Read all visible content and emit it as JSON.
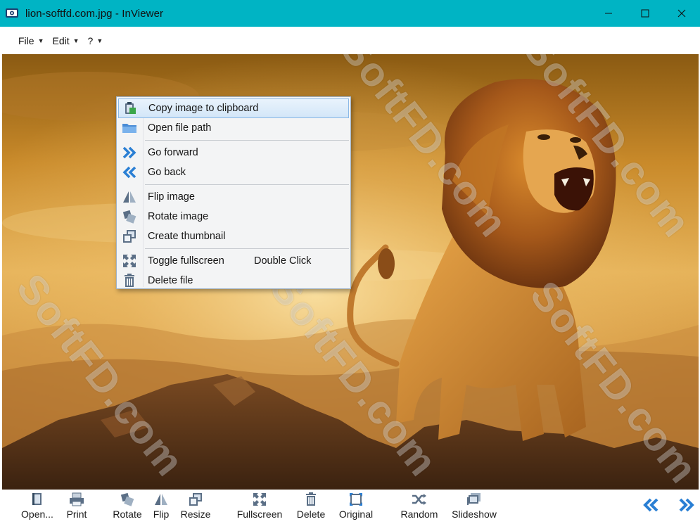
{
  "window": {
    "title": "lion-softfd.com.jpg - InViewer",
    "icon": "app-icon"
  },
  "menubar": {
    "items": [
      {
        "label": "File"
      },
      {
        "label": "Edit"
      },
      {
        "label": "?"
      }
    ]
  },
  "watermark": "SoftFD.com",
  "context_menu": {
    "items": [
      {
        "label": "Copy image to clipboard",
        "icon": "clipboard-icon",
        "highlighted": true
      },
      {
        "label": "Open file path",
        "icon": "folder-icon"
      },
      {
        "label": "Go forward",
        "icon": "double-chevron-right-icon"
      },
      {
        "label": "Go back",
        "icon": "double-chevron-left-icon"
      },
      {
        "label": "Flip image",
        "icon": "flip-icon"
      },
      {
        "label": "Rotate image",
        "icon": "rotate-icon"
      },
      {
        "label": "Create thumbnail",
        "icon": "thumbnail-icon"
      },
      {
        "label": "Toggle fullscreen",
        "shortcut": "Double Click",
        "icon": "fullscreen-icon"
      },
      {
        "label": "Delete file",
        "icon": "trash-icon"
      }
    ]
  },
  "toolbar": {
    "buttons": [
      {
        "label": "Open...",
        "icon": "open-book-icon"
      },
      {
        "label": "Print",
        "icon": "printer-icon"
      },
      {
        "label": "Rotate",
        "icon": "rotate-icon"
      },
      {
        "label": "Flip",
        "icon": "flip-icon"
      },
      {
        "label": "Resize",
        "icon": "resize-icon"
      },
      {
        "label": "Fullscreen",
        "icon": "fullscreen-icon"
      },
      {
        "label": "Delete",
        "icon": "trash-icon"
      },
      {
        "label": "Original",
        "icon": "original-size-icon"
      },
      {
        "label": "Random",
        "icon": "shuffle-icon"
      },
      {
        "label": "Slideshow",
        "icon": "slideshow-icon"
      }
    ],
    "prev_icon": "double-chevron-left-icon",
    "next_icon": "double-chevron-right-icon"
  },
  "colors": {
    "titlebar": "#00b4c4",
    "accent_blue": "#2a7fd4",
    "icon_gray": "#5b6f86"
  }
}
